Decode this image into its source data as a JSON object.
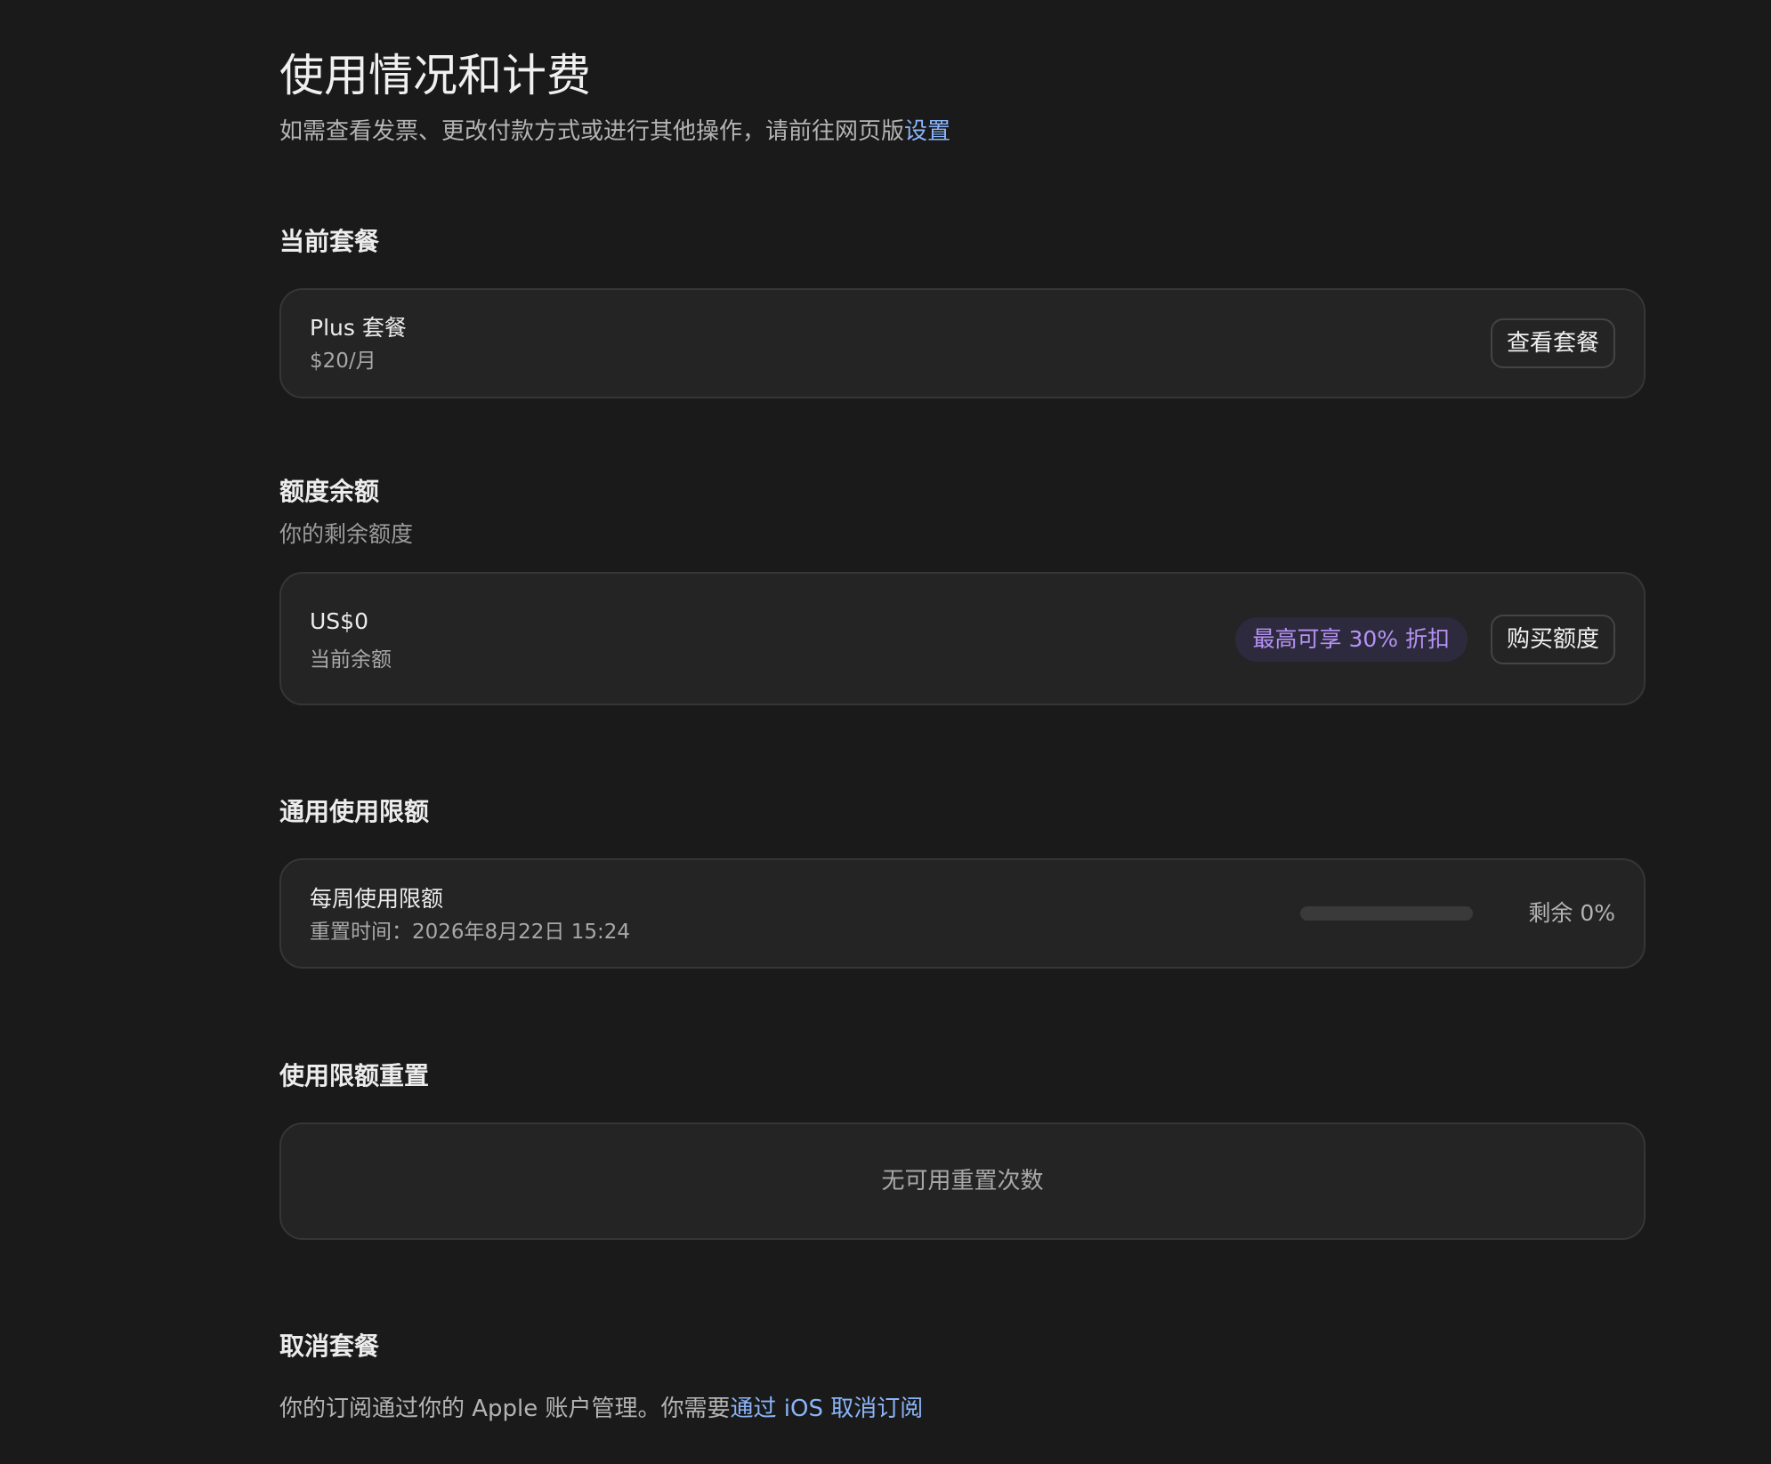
{
  "header": {
    "title": "使用情况和计费",
    "subtitle_prefix": "如需查看发票、更改付款方式或进行其他操作，请前往网页版",
    "subtitle_link": "设置"
  },
  "current_plan": {
    "heading": "当前套餐",
    "plan_name": "Plus 套餐",
    "price": "$20/月",
    "button_label": "查看套餐"
  },
  "credit_balance": {
    "heading": "额度余额",
    "description": "你的剩余额度",
    "amount": "US$0",
    "amount_label": "当前余额",
    "discount_badge": "最高可享 30% 折扣",
    "button_label": "购买额度"
  },
  "usage_limits": {
    "heading": "通用使用限额",
    "item_title": "每周使用限额",
    "reset_time": "重置时间：2026年8月22日 15:24",
    "remaining_label": "剩余 0%",
    "remaining_fraction": 0
  },
  "limit_reset": {
    "heading": "使用限额重置",
    "empty_message": "无可用重置次数"
  },
  "cancel_plan": {
    "heading": "取消套餐",
    "text_prefix": "你的订阅通过你的 Apple 账户管理。你需要",
    "link_text": "通过 iOS 取消订阅"
  },
  "colors": {
    "background": "#1a1a1a",
    "card": "#242424",
    "link": "#8ab4f8",
    "badge_text": "#b692f6",
    "badge_bg": "#2e2a3d"
  }
}
